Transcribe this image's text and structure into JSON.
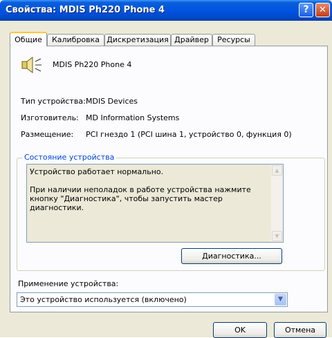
{
  "window": {
    "title": "Свойства: MDIS Ph220 Phone 4",
    "help_glyph": "?",
    "close_glyph": "✕"
  },
  "tabs": [
    {
      "label": "Общие",
      "active": true
    },
    {
      "label": "Калибровка",
      "active": false
    },
    {
      "label": "Дискретизация",
      "active": false
    },
    {
      "label": "Драйвер",
      "active": false
    },
    {
      "label": "Ресурсы",
      "active": false
    }
  ],
  "device": {
    "icon": "speaker-icon",
    "name": "MDIS Ph220 Phone 4",
    "type_label": "Тип устройства:",
    "type_value": "MDIS Devices",
    "manufacturer_label": "Изготовитель:",
    "manufacturer_value": "MD Information Systems",
    "location_label": "Размещение:",
    "location_value": "PCI гнездо 1 (PCI шина 1, устройство 0, функция 0)"
  },
  "status": {
    "group_title": "Состояние устройства",
    "text": "Устройство работает нормально.\n\nПри наличии неполадок в работе устройства нажмите кнопку \"Диагностика\", чтобы запустить мастер диагностики.",
    "troubleshoot_button": "Диагностика..."
  },
  "usage": {
    "label": "Применение устройства:",
    "selected": "Это устройство используется (включено)"
  },
  "footer": {
    "ok": "OK",
    "cancel": "Отмена"
  },
  "colors": {
    "title_blue": "#0054e3",
    "group_title": "#0046d5",
    "face": "#ece9d8"
  }
}
